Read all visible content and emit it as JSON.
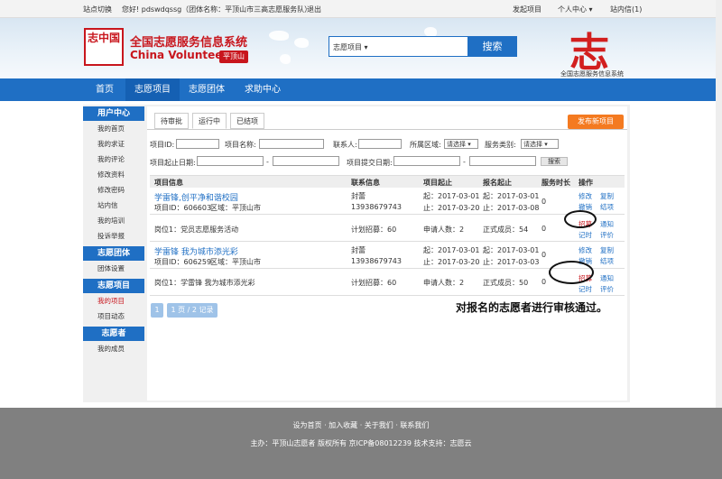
{
  "topbar": {
    "site_switch": "站点切换",
    "greeting": "您好! pdswdqssg（团体名称：平顶山市三高志愿服务队）",
    "logout": "退出",
    "post_project": "发起项目",
    "personal_center": "个人中心",
    "mailbox": "站内信(1)"
  },
  "header": {
    "logo_text": "志中国",
    "title_cn": "全国志愿服务信息系统",
    "title_en": "China Volunteer",
    "city": "平顶山",
    "search_select": "志愿项目",
    "search_button": "搜索",
    "brand_char": "志",
    "brand_caption": "全国志愿服务信息系统"
  },
  "nav": {
    "items": [
      "首页",
      "志愿项目",
      "志愿团体",
      "求助中心"
    ],
    "active": "志愿项目"
  },
  "sidebar": {
    "sections": [
      {
        "title": "用户中心",
        "links": [
          "我的首页",
          "我的求证",
          "我的评论",
          "修改资料",
          "修改密码",
          "站内信",
          "我的培训",
          "投诉举报"
        ]
      },
      {
        "title": "志愿团体",
        "links": [
          "团体设置"
        ]
      },
      {
        "title": "志愿项目",
        "links": [
          "我的项目",
          "项目动态"
        ]
      },
      {
        "title": "志愿者",
        "links": [
          "我的成员"
        ]
      }
    ],
    "active_link": "我的项目"
  },
  "tabs": [
    "待审批",
    "运行中",
    "已结项"
  ],
  "active_tab": "运行中",
  "publish_button": "发布新项目",
  "filters": {
    "project_id": "项目ID:",
    "project_name": "项目名称:",
    "contact": "联系人:",
    "region": "所属区域:",
    "region_value": "请选择",
    "service_type": "服务类别:",
    "service_value": "请选择",
    "start_date": "项目起止日期:",
    "submit_date": "项目提交日期:",
    "dash": "-",
    "search": "搜索"
  },
  "table": {
    "headers": [
      "项目信息",
      "联系信息",
      "项目起止",
      "报名起止",
      "服务时长",
      "操作"
    ],
    "projects": [
      {
        "name": "学雷锋,创平净和谐校园",
        "id_line": "项目ID：606603",
        "region": "区域：平顶山市",
        "contact_name": "封蕾",
        "phone": "13938679743",
        "proj_start": "起：2017-03-01",
        "proj_end": "止：2017-03-20",
        "enroll_start": "起：2017-03-01",
        "enroll_end": "止：2017-03-08",
        "hours": "0",
        "ops": [
          "修改",
          "复制",
          "撤销",
          "结项"
        ],
        "position": "岗位1：党员志愿服务活动",
        "plan": "计划招募：60",
        "applicants": "申请人数：2",
        "members": "正式成员：54",
        "pos_hours": "0",
        "pos_ops": [
          "招募",
          "通知",
          "记时",
          "评价"
        ]
      },
      {
        "name": "学雷锋 我为城市添光彩",
        "id_line": "项目ID：606259",
        "region": "区域：平顶山市",
        "contact_name": "封蕾",
        "phone": "13938679743",
        "proj_start": "起：2017-03-01",
        "proj_end": "止：2017-03-20",
        "enroll_start": "起：2017-03-01",
        "enroll_end": "止：2017-03-03",
        "hours": "0",
        "ops": [
          "修改",
          "复制",
          "撤销",
          "结项"
        ],
        "position": "岗位1：学雷锋 我为城市添光彩",
        "plan": "计划招募：60",
        "applicants": "申请人数：2",
        "members": "正式成员：50",
        "pos_hours": "0",
        "pos_ops": [
          "招募",
          "通知",
          "记时",
          "评价"
        ]
      }
    ]
  },
  "pager": {
    "page": "1",
    "info": "1 页 / 2 记录"
  },
  "annotation": "对报名的志愿者进行审核通过。",
  "footer": {
    "links": "设为首页  ·  加入收藏  ·  关于我们  ·  联系我们",
    "copyright": "主办：平顶山志愿者 版权所有 京ICP备08012239  技术支持：志愿云"
  }
}
